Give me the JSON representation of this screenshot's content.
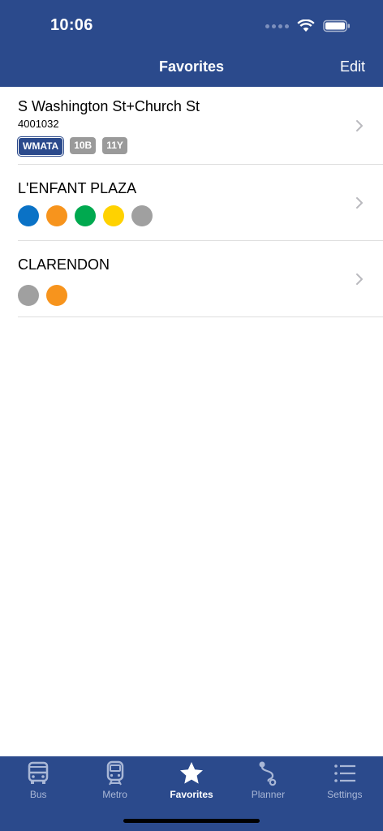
{
  "status_bar": {
    "time": "10:06"
  },
  "nav": {
    "title": "Favorites",
    "edit_label": "Edit"
  },
  "favorites": [
    {
      "title": "S Washington St+Church St",
      "stop_id": "4001032",
      "agency": "WMATA",
      "routes": [
        "10B",
        "11Y"
      ]
    },
    {
      "title": "L'ENFANT PLAZA",
      "line_colors": [
        "#0a72c6",
        "#f7941d",
        "#00a94f",
        "#ffd200",
        "#a0a0a0"
      ]
    },
    {
      "title": "CLARENDON",
      "line_colors": [
        "#a0a0a0",
        "#f7941d"
      ]
    }
  ],
  "tabs": [
    {
      "label": "Bus",
      "icon": "bus-icon",
      "active": false
    },
    {
      "label": "Metro",
      "icon": "metro-icon",
      "active": false
    },
    {
      "label": "Favorites",
      "icon": "star-icon",
      "active": true
    },
    {
      "label": "Planner",
      "icon": "route-icon",
      "active": false
    },
    {
      "label": "Settings",
      "icon": "list-icon",
      "active": false
    }
  ],
  "colors": {
    "header_bg": "#2b4a8c",
    "tab_inactive": "#a9b7d6",
    "tab_active": "#ffffff",
    "route_tag": "#9a9a9a",
    "separator": "#dedede"
  }
}
